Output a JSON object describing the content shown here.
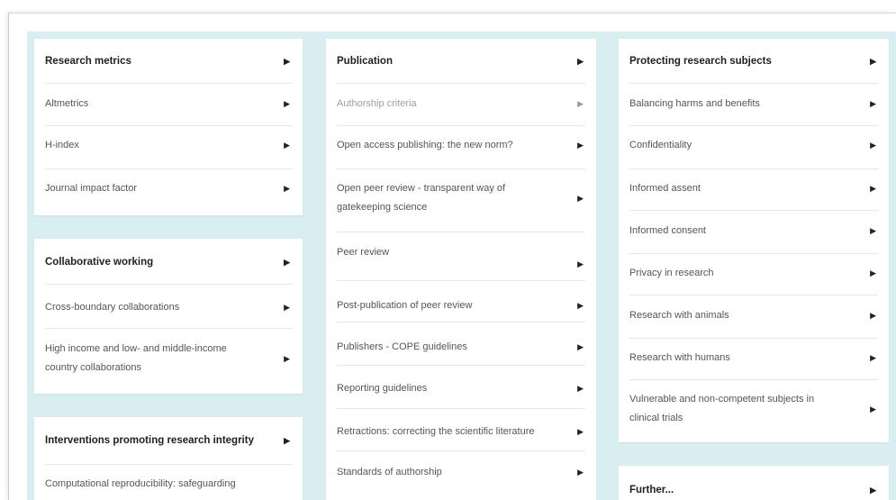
{
  "columns": [
    {
      "sections": [
        {
          "title": "Research metrics",
          "items": [
            "Altmetrics",
            "H-index",
            "Journal impact factor"
          ]
        },
        {
          "title": "Collaborative working",
          "items": [
            "Cross-boundary collaborations",
            "High income and low- and middle-income country collaborations"
          ]
        },
        {
          "title": "Interventions promoting research integrity",
          "items": [
            "Computational reproducibility: safeguarding"
          ]
        }
      ]
    },
    {
      "sections": [
        {
          "title": "Publication",
          "items": [
            "Authorship criteria",
            "Open access publishing: the new norm?",
            "Open peer review - transparent way of gatekeeping science",
            "Peer review",
            "Post-publication of peer review",
            "Publishers - COPE guidelines",
            "Reporting guidelines",
            "Retractions: correcting the scientific literature",
            "Standards of authorship"
          ]
        }
      ]
    },
    {
      "sections": [
        {
          "title": "Protecting research subjects",
          "items": [
            "Balancing harms and benefits",
            "Confidentiality",
            "Informed assent",
            "Informed consent",
            "Privacy in research",
            "Research with animals",
            "Research with humans",
            "Vulnerable and non-competent subjects in clinical trials"
          ]
        },
        {
          "title": "Further...",
          "items": []
        }
      ]
    }
  ],
  "icons": {
    "chevron": "chevron-right-icon",
    "glyph": "▶"
  },
  "colors": {
    "background": "#d8eef1",
    "card": "#ffffff",
    "muted_item": "#9aa3a6"
  }
}
